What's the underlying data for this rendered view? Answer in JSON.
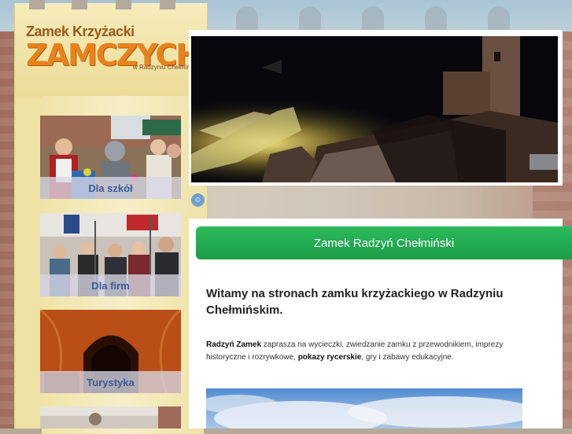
{
  "logo": {
    "line1": "Zamek Krzyżacki",
    "main": "ZAMCZYCHO",
    "sub": "w Radzyniu Chełmińskim"
  },
  "sidebar": {
    "cards": [
      {
        "label": "Dla szkół"
      },
      {
        "label": "Dla firm"
      },
      {
        "label": "Turystyka"
      },
      {
        "label": ""
      }
    ]
  },
  "content": {
    "title": "Zamek Radzyń Chełmiński",
    "welcome": "Witamy na stronach zamku krzyżackiego w Radzyniu Chełmińskim.",
    "intro": {
      "part1_bold": "Radzyń Zamek",
      "part2": " zaprasza na wycieczki, zwiedzanie zamku z przewodnikiem, imprezy historyczne i rozrywkowe, ",
      "part3_bold": "pokazy rycerskie",
      "part4": ", gry i zabawy edukacyjne."
    }
  },
  "icons": {
    "tooth": "tooth-icon"
  },
  "colors": {
    "title_bar": "#1d9d47",
    "tower": "#efe2a5",
    "logo_orange": "#e8821b",
    "card_label": "#3a5a9a"
  }
}
